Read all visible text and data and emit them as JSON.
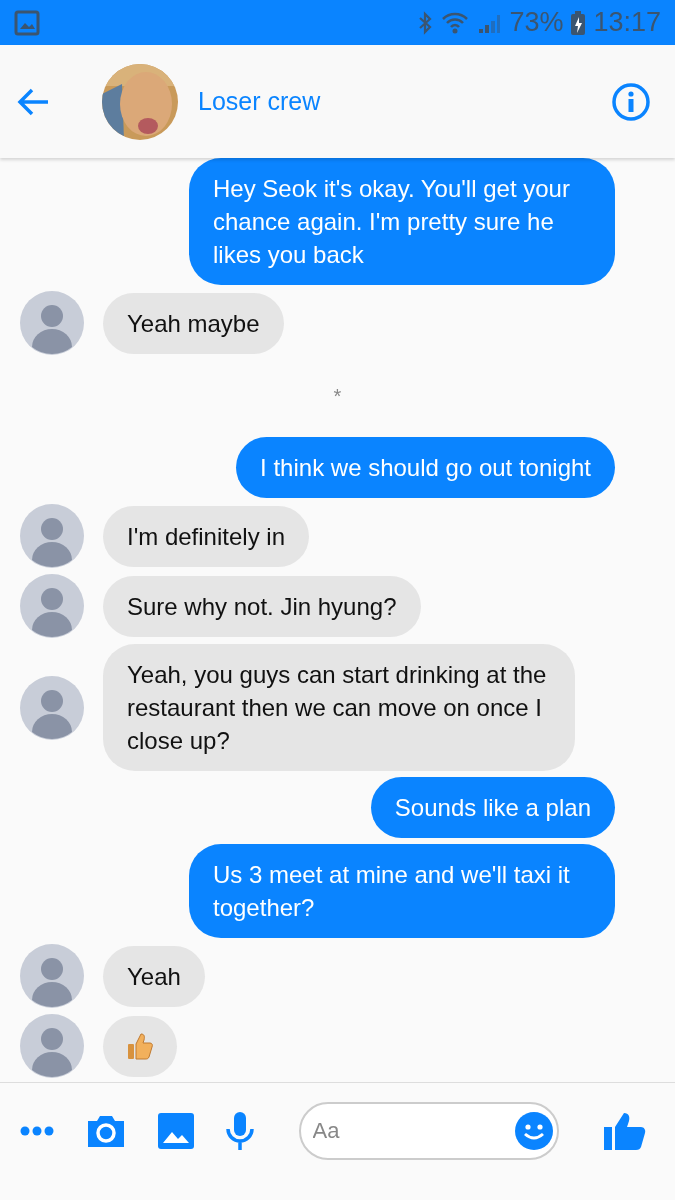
{
  "status_bar": {
    "battery": "73%",
    "time": "13:17"
  },
  "header": {
    "title": "Loser crew"
  },
  "messages": [
    {
      "kind": "sent",
      "text": "Hey Seok it's okay. You'll get your chance again. I'm pretty sure he likes you back"
    },
    {
      "kind": "received",
      "text": "Yeah maybe"
    },
    {
      "kind": "separator",
      "text": "*"
    },
    {
      "kind": "sent",
      "text": "I think we should go out tonight"
    },
    {
      "kind": "received",
      "text": "I'm definitely in"
    },
    {
      "kind": "received",
      "text": "Sure why not. Jin hyung?"
    },
    {
      "kind": "received",
      "text": "Yeah, you guys can start drinking at the restaurant then we can move on once I close up?"
    },
    {
      "kind": "sent",
      "text": "Sounds like a plan"
    },
    {
      "kind": "sent",
      "text": "Us 3 meet at mine and we'll taxi it together?"
    },
    {
      "kind": "received",
      "text": "Yeah"
    },
    {
      "kind": "like"
    }
  ],
  "composer": {
    "placeholder": "Aa"
  }
}
